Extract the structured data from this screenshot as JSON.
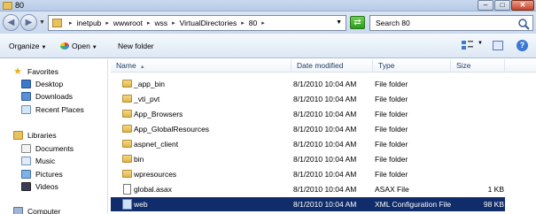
{
  "window": {
    "title": "80"
  },
  "address": {
    "crumbs": [
      "inetpub",
      "wwwroot",
      "wss",
      "VirtualDirectories",
      "80"
    ],
    "search_placeholder": "Search 80"
  },
  "toolbar": {
    "organize": "Organize",
    "open": "Open",
    "new_folder": "New folder"
  },
  "nav": {
    "favorites": "Favorites",
    "desktop": "Desktop",
    "downloads": "Downloads",
    "recent": "Recent Places",
    "libraries": "Libraries",
    "documents": "Documents",
    "music": "Music",
    "pictures": "Pictures",
    "videos": "Videos",
    "computer": "Computer"
  },
  "columns": {
    "name": "Name",
    "date": "Date modified",
    "type": "Type",
    "size": "Size"
  },
  "files": [
    {
      "name": "_app_bin",
      "date": "8/1/2010 10:04 AM",
      "type": "File folder",
      "size": ""
    },
    {
      "name": "_vti_pvt",
      "date": "8/1/2010 10:04 AM",
      "type": "File folder",
      "size": ""
    },
    {
      "name": "App_Browsers",
      "date": "8/1/2010 10:04 AM",
      "type": "File folder",
      "size": ""
    },
    {
      "name": "App_GlobalResources",
      "date": "8/1/2010 10:04 AM",
      "type": "File folder",
      "size": ""
    },
    {
      "name": "aspnet_client",
      "date": "8/1/2010 10:04 AM",
      "type": "File folder",
      "size": ""
    },
    {
      "name": "bin",
      "date": "8/1/2010 10:04 AM",
      "type": "File folder",
      "size": ""
    },
    {
      "name": "wpresources",
      "date": "8/1/2010 10:04 AM",
      "type": "File folder",
      "size": ""
    },
    {
      "name": "global.asax",
      "date": "8/1/2010 10:04 AM",
      "type": "ASAX File",
      "size": "1 KB"
    },
    {
      "name": "web",
      "date": "8/1/2010 10:04 AM",
      "type": "XML Configuration File",
      "size": "98 KB"
    }
  ]
}
